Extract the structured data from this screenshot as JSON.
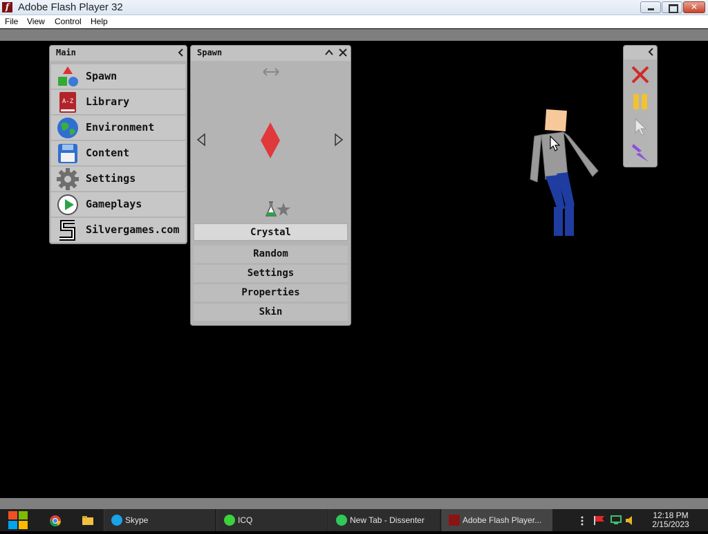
{
  "window": {
    "title": "Adobe Flash Player 32",
    "close_glyph": "✕"
  },
  "menubar": {
    "items": [
      "File",
      "View",
      "Control",
      "Help"
    ]
  },
  "main_panel": {
    "title": "Main",
    "items": [
      {
        "label": "Spawn",
        "icon": "spawn-shapes-icon"
      },
      {
        "label": "Library",
        "icon": "library-book-icon"
      },
      {
        "label": "Environment",
        "icon": "globe-icon"
      },
      {
        "label": "Content",
        "icon": "floppy-disk-icon"
      },
      {
        "label": "Settings",
        "icon": "gear-icon"
      },
      {
        "label": "Gameplays",
        "icon": "play-icon"
      },
      {
        "label": "Silvergames.com",
        "icon": "silvergames-logo-icon"
      }
    ],
    "library_icon_text": "A-Z"
  },
  "spawn_panel": {
    "title": "Spawn",
    "selected_item": "Crystal",
    "buttons": [
      "Random",
      "Settings",
      "Properties",
      "Skin"
    ],
    "crystal_color": "#e0393b"
  },
  "tool_panel": {
    "tools": [
      "delete-x-icon",
      "pause-icon",
      "pointer-icon",
      "lightning-icon"
    ]
  },
  "taskbar": {
    "items": [
      {
        "label": "Skype",
        "icon": "skype-icon",
        "color": "#1aa3e6"
      },
      {
        "label": "ICQ",
        "icon": "icq-icon",
        "color": "#3bd23b"
      },
      {
        "label": "New Tab - Dissenter",
        "icon": "dissenter-icon",
        "color": "#2fc85a"
      },
      {
        "label": "Adobe Flash Player...",
        "icon": "flash-icon",
        "color": "#8a1414"
      }
    ],
    "time": "12:18 PM",
    "date": "2/15/2023"
  },
  "colors": {
    "panel_bg": "#b4b4b4",
    "ragdoll_shirt": "#9a9a9a",
    "ragdoll_pants": "#1f3ca0",
    "ragdoll_skin": "#f7c99a"
  }
}
